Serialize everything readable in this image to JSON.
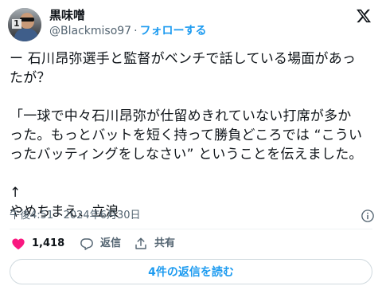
{
  "user": {
    "display_name": "黒味噌",
    "handle": "@Blackmiso97",
    "separator": "·",
    "follow_label": "フォローする",
    "avatar_jersey_number": "1"
  },
  "tweet": {
    "lines": [
      "ー 石川昂弥選手と監督がベンチで話している場面があっ",
      "たが？",
      "",
      "「一球で中々石川昂弥が仕留めきれていない打席が多か",
      "った。もっとバットを短く持って勝負どころでは “こうい",
      "ったバッティングをしなさい” ということを伝えました。",
      "",
      "↑",
      "やめちまえ、立浪"
    ]
  },
  "meta": {
    "timestamp": "午後4:51 · 2024年6月30日"
  },
  "actions": {
    "like_count": "1,418",
    "reply_label": "返信",
    "share_label": "共有"
  },
  "read_replies_label": "4件の返信を読む",
  "colors": {
    "accent": "#1d9bf0",
    "like": "#f91880",
    "text": "#0f1419",
    "secondary": "#536471"
  },
  "icons": [
    "x-logo-icon",
    "info-icon",
    "heart-icon",
    "reply-icon",
    "share-icon"
  ]
}
